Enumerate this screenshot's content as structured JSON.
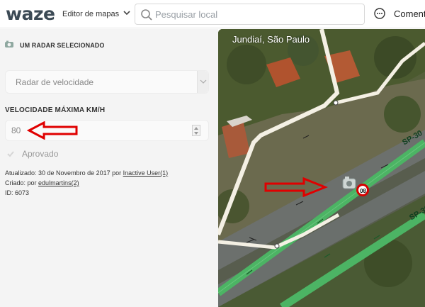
{
  "app": {
    "logo": "waze",
    "name": "Editor de mapas"
  },
  "search": {
    "placeholder": "Pesquisar local",
    "value": ""
  },
  "header": {
    "comment_label": "Comentários"
  },
  "panel": {
    "selection_title": "UM RADAR SELECIONADO",
    "type_select": {
      "selected": "Radar de velocidade"
    },
    "speed": {
      "label": "VELOCIDADE MÁXIMA KM/H",
      "value": "80"
    },
    "approved_label": "Aprovado",
    "metadata": {
      "updated_prefix": "Atualizado: 30 de Novembro de 2017 por",
      "updated_user": "Inactive User(1)",
      "created_prefix": "Criado: por",
      "created_user": "edulmartins(2)",
      "id_text": "ID: 6073"
    }
  },
  "map": {
    "location": "Jundiaí, São Paulo",
    "road_label": "SP-30",
    "speed_limit_badge": "80",
    "road_color": "#4cb464",
    "street_color": "#f4f0e4",
    "annotation_color": "#e00000"
  }
}
